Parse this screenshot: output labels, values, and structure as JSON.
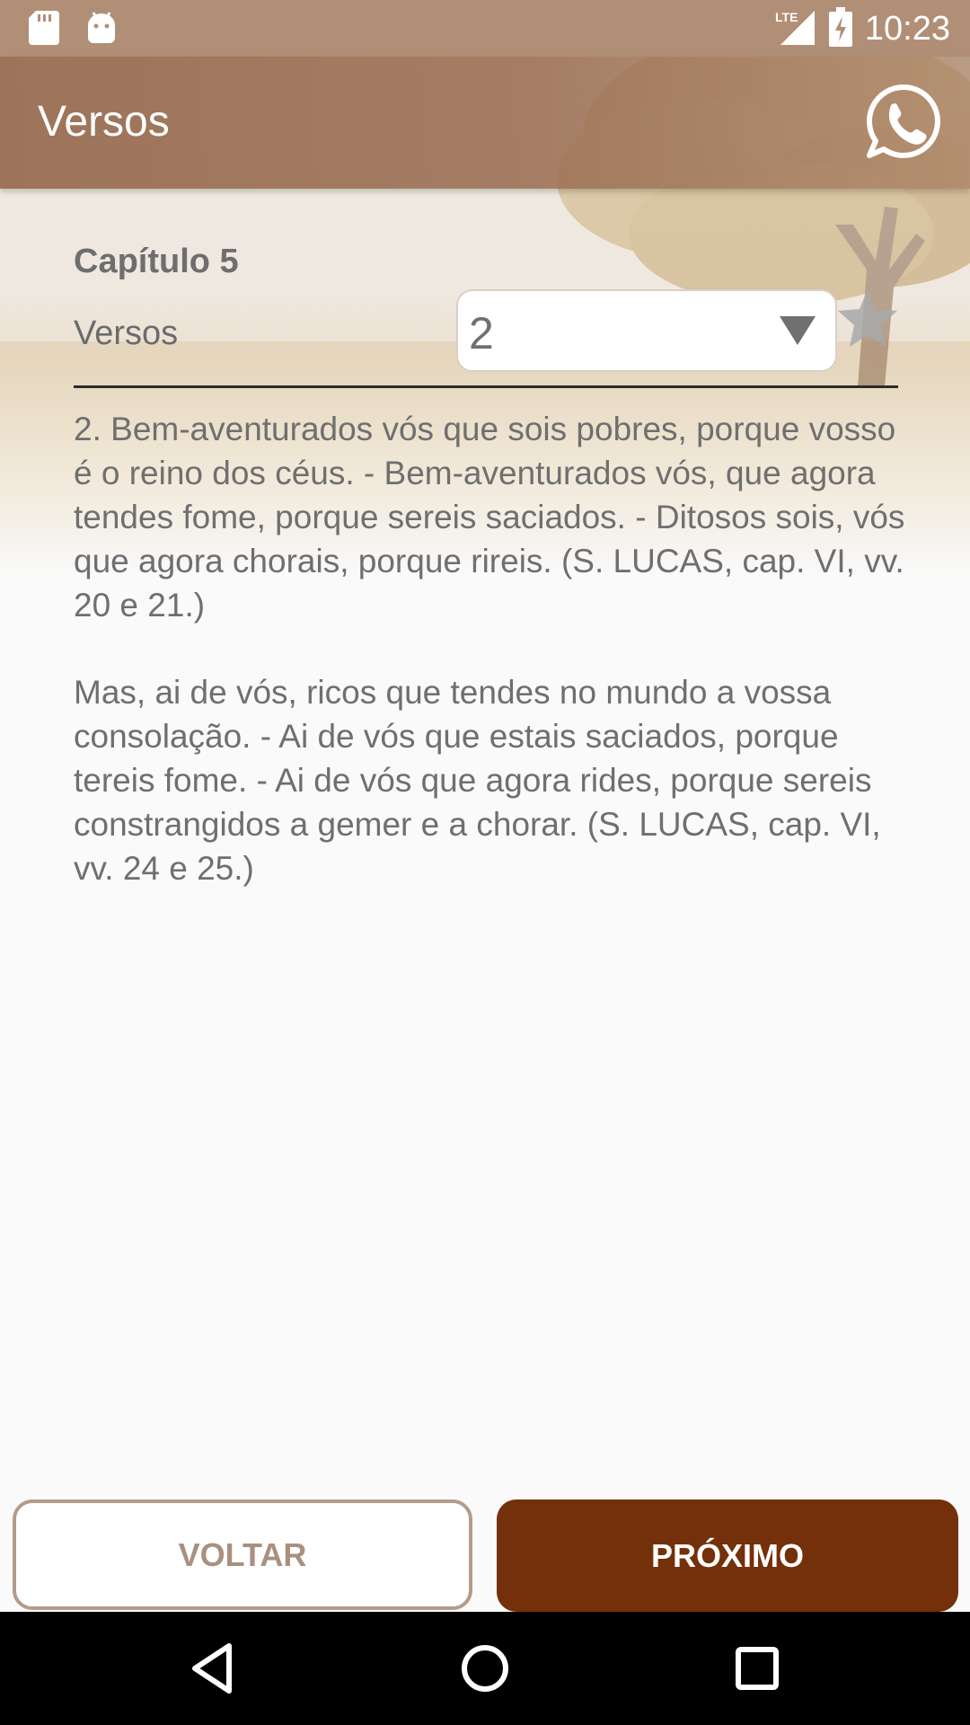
{
  "status_bar": {
    "time": "10:23",
    "network": "LTE",
    "icons": [
      "sd-card-icon",
      "android-icon",
      "signal-icon",
      "battery-charging-icon"
    ]
  },
  "app_bar": {
    "title": "Versos",
    "share_icon": "whatsapp-icon"
  },
  "content": {
    "chapter": "Capítulo 5",
    "verse_label": "Versos",
    "verse_select": {
      "value": "2"
    },
    "favorite_icon": "star-icon",
    "paragraphs": [
      "2. Bem-aventurados vós que sois pobres, porque vosso é o reino dos céus. - Bem-aventurados vós, que agora tendes fome, porque sereis saciados. - Ditosos sois, vós que agora chorais, porque rireis. (S. LUCAS, cap. VI, vv. 20 e 21.)",
      "Mas, ai de vós, ricos que tendes no mundo a vossa consolação. - Ai de vós que estais saciados, porque tereis fome. - Ai de vós que agora rides, porque sereis constrangidos a gemer e a chorar. (S. LUCAS, cap. VI, vv. 24 e 25.)"
    ]
  },
  "buttons": {
    "back": "VOLTAR",
    "next": "PRÓXIMO"
  },
  "nav_bar": {
    "icons": [
      "back-icon",
      "home-icon",
      "recents-icon"
    ]
  },
  "colors": {
    "status_bar": "#b18f77",
    "app_bar": "#9a6e52",
    "primary_button": "#74300a",
    "secondary_border": "#b49b8c"
  }
}
